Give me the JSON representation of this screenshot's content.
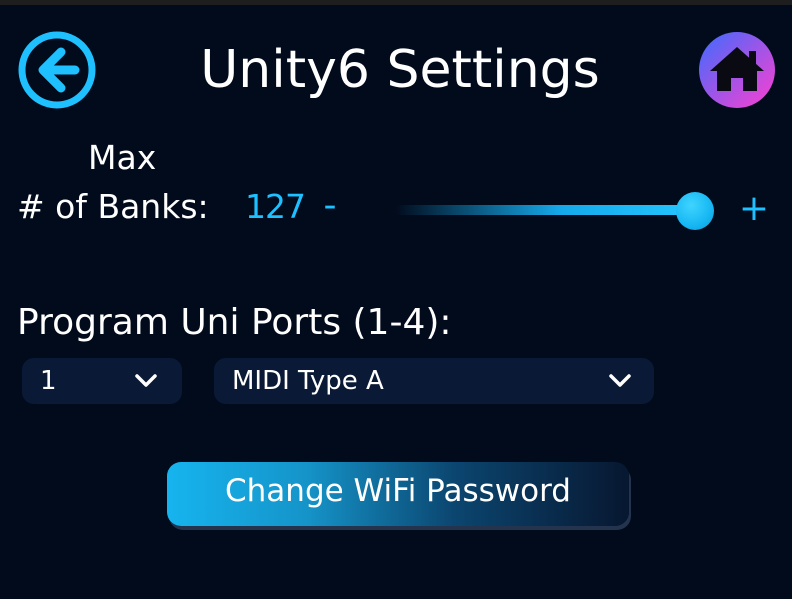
{
  "header": {
    "title": "Unity6 Settings",
    "back_icon": "arrow-left-circle-icon",
    "home_icon": "home-icon"
  },
  "banks": {
    "label_line1": "Max",
    "label_line2": "# of Banks:",
    "value": "127",
    "minus_label": "-",
    "plus_label": "+",
    "slider_level": 1.0
  },
  "ports": {
    "label": "Program Uni Ports (1-4):",
    "port_select": {
      "value": "1"
    },
    "type_select": {
      "value": "MIDI Type A"
    }
  },
  "wifi": {
    "button_label": "Change WiFi Password"
  },
  "colors": {
    "background": "#020b1c",
    "accent": "#1ec0ff",
    "select_bg": "#0a1a36",
    "home_gradient_start": "#3b6cff",
    "home_gradient_end": "#ff3fd0"
  }
}
